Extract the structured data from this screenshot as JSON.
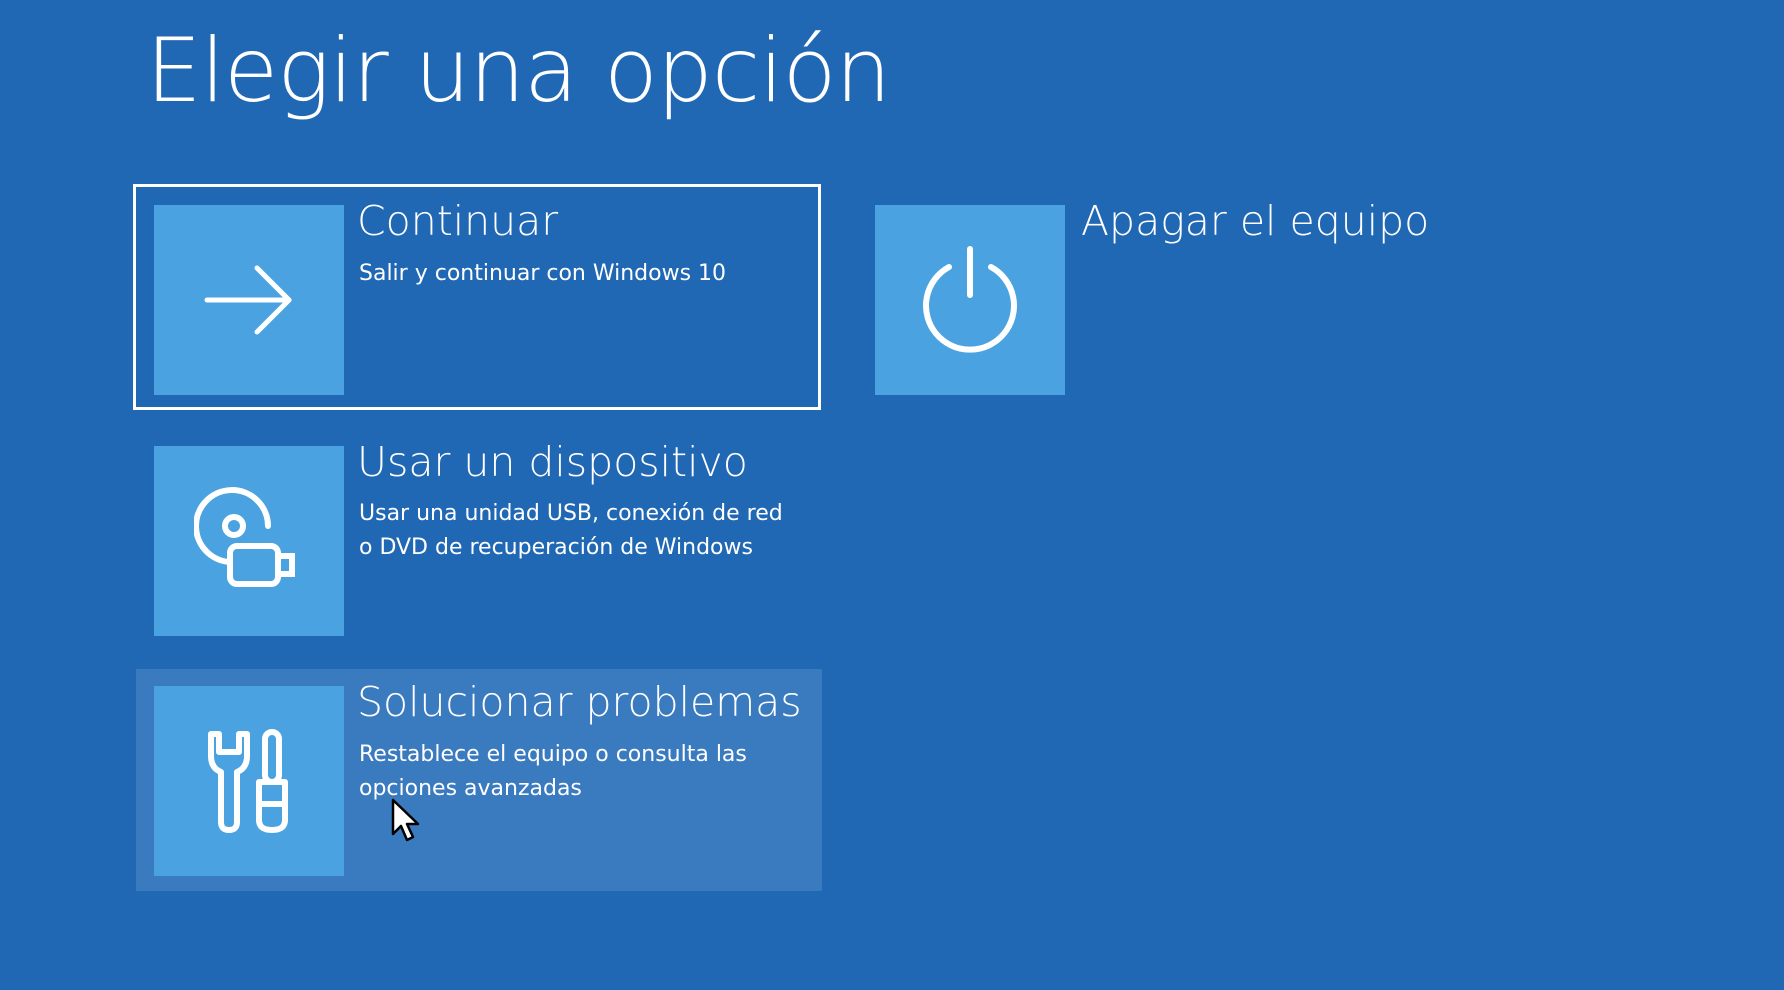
{
  "page": {
    "title": "Elegir una opción",
    "background_color": "#2067b4",
    "tile_color": "#4aa3e0",
    "hover_color": "#3a7abf"
  },
  "options": [
    {
      "id": "continue",
      "icon": "arrow-right-icon",
      "title": "Continuar",
      "description": "Salir y continuar con Windows 10",
      "state": "focused"
    },
    {
      "id": "use-device",
      "icon": "usb-disc-icon",
      "title": "Usar un dispositivo",
      "description": "Usar una unidad USB, conexión de red o DVD de recuperación de Windows",
      "state": "normal"
    },
    {
      "id": "troubleshoot",
      "icon": "tools-icon",
      "title": "Solucionar problemas",
      "description": "Restablece el equipo o consulta las opciones avanzadas",
      "state": "hovered"
    },
    {
      "id": "shutdown",
      "icon": "power-icon",
      "title": "Apagar el equipo",
      "description": "",
      "state": "normal"
    }
  ],
  "cursor": {
    "icon": "mouse-pointer-icon"
  }
}
